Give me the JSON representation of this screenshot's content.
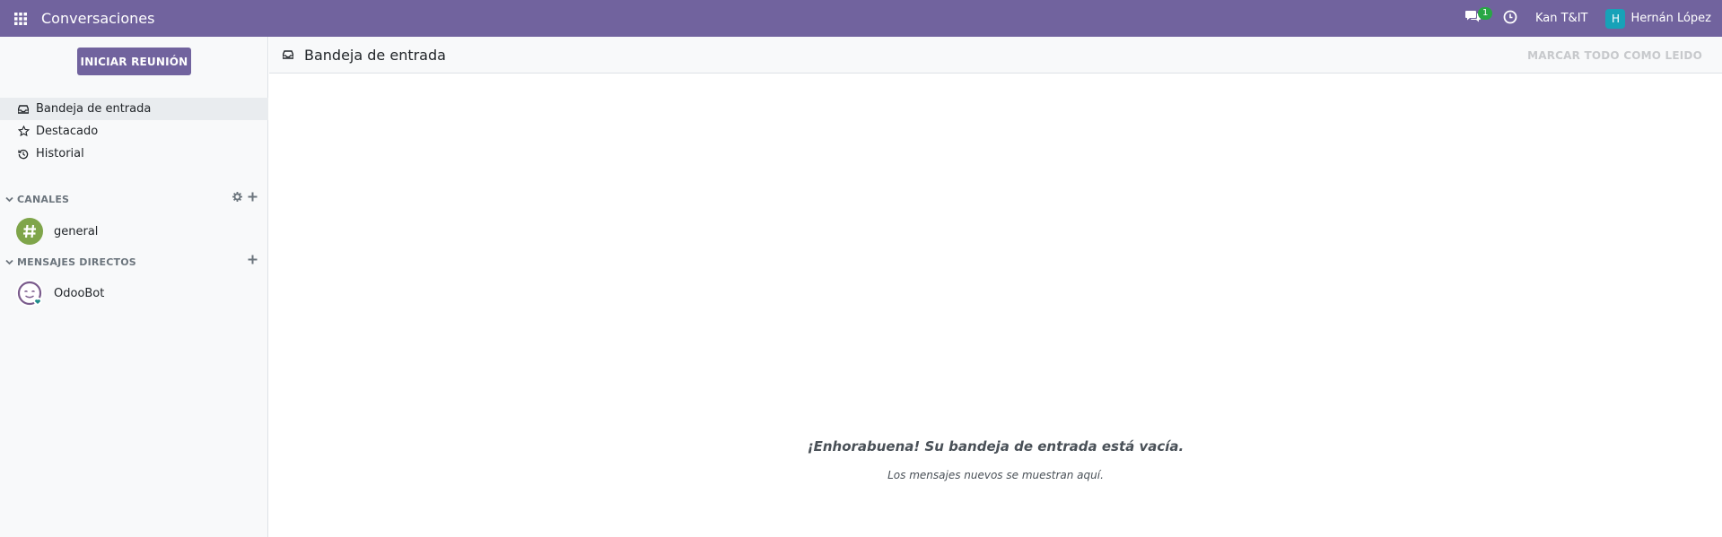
{
  "navbar": {
    "app_name": "Conversaciones",
    "messages_badge": "1",
    "company": "Kan T&IT",
    "user_initial": "H",
    "user_name": "Hernán López"
  },
  "sidebar": {
    "start_meeting_label": "INICIAR REUNIÓN",
    "mailboxes": [
      {
        "label": "Bandeja de entrada",
        "icon": "inbox-icon",
        "active": true
      },
      {
        "label": "Destacado",
        "icon": "star-icon",
        "active": false
      },
      {
        "label": "Historial",
        "icon": "history-icon",
        "active": false
      }
    ],
    "channels_title": "CANALES",
    "channels": [
      {
        "name": "general"
      }
    ],
    "direct_title": "MENSAJES DIRECTOS",
    "direct_messages": [
      {
        "name": "OdooBot"
      }
    ]
  },
  "main": {
    "title": "Bandeja de entrada",
    "mark_all_label": "MARCAR TODO COMO LEIDO",
    "empty_title": "¡Enhorabuena! Su bandeja de entrada está vacía.",
    "empty_subtitle": "Los mensajes nuevos se muestran aquí."
  },
  "colors": {
    "brand": "#71639e",
    "badge": "#28a745",
    "channel_avatar": "#7fa54a"
  }
}
